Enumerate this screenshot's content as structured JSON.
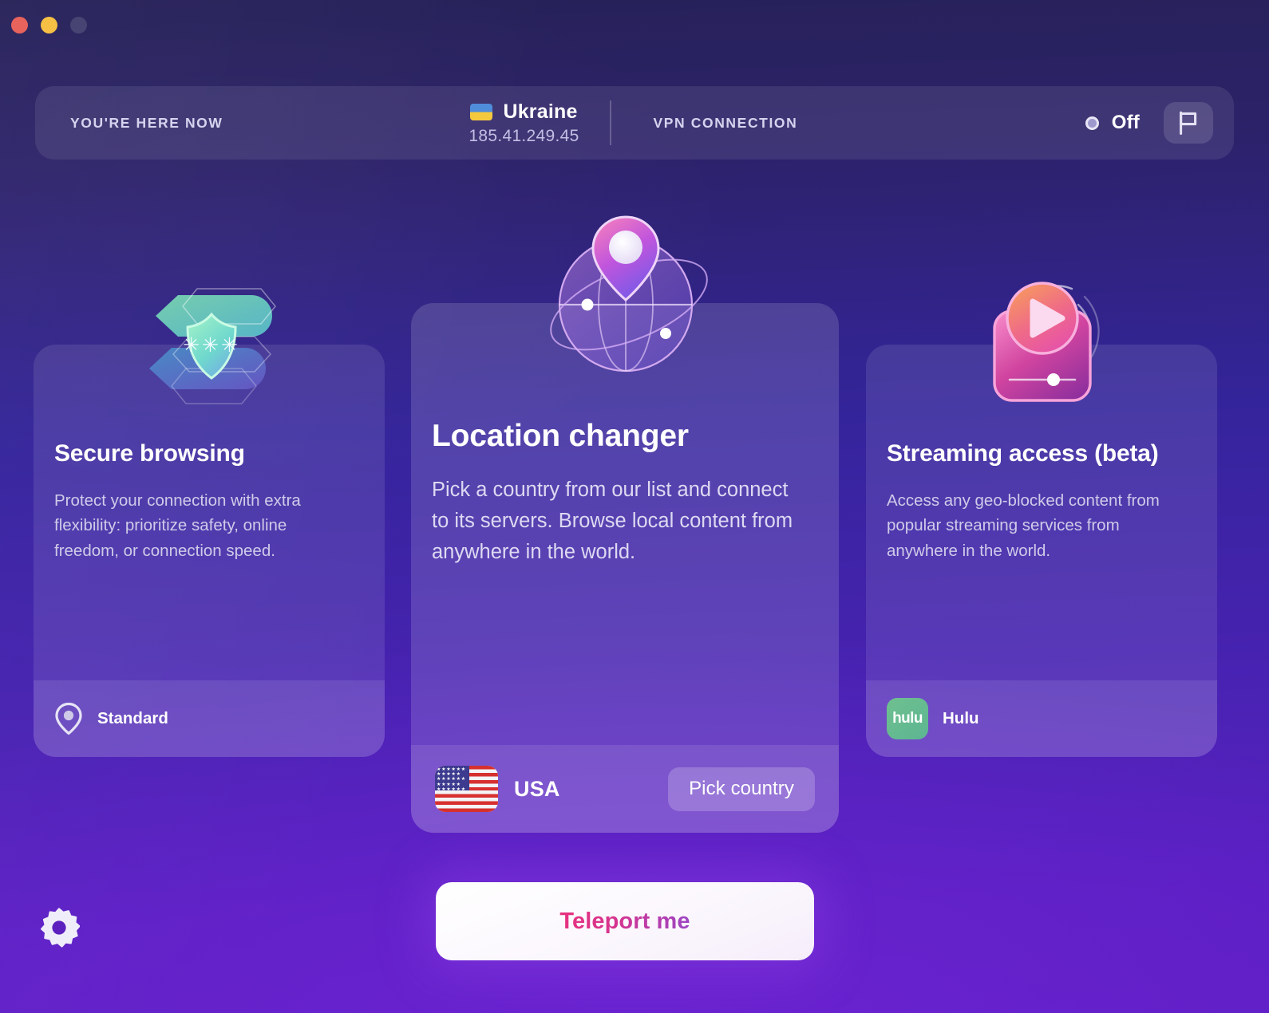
{
  "window": {
    "controls": [
      {
        "name": "close",
        "color": "#e8635c"
      },
      {
        "name": "minimize",
        "color": "#f5c043"
      },
      {
        "name": "zoom",
        "color": "#474473"
      }
    ]
  },
  "header": {
    "here_now_label": "YOU'RE HERE NOW",
    "country_name": "Ukraine",
    "country_flag": "ukraine-flag-icon",
    "ip_address": "185.41.249.45",
    "vpn_label": "VPN CONNECTION",
    "vpn_status": "Off",
    "status_icon": "status-ring-icon",
    "flag_button_icon": "flag-icon"
  },
  "cards": {
    "secure": {
      "icon": "shield-asterisks-icon",
      "title": "Secure browsing",
      "description": "Protect your connection with extra flexibility: prioritize safety, online freedom, or connection speed.",
      "footer_icon": "location-pin-icon",
      "footer_label": "Standard"
    },
    "location": {
      "icon": "globe-pin-icon",
      "title": "Location changer",
      "description": "Pick a country from our list and connect to its servers. Browse local content from anywhere in the world.",
      "footer_flag": "usa-flag-icon",
      "footer_label": "USA",
      "pick_button": "Pick country"
    },
    "streaming": {
      "icon": "video-player-icon",
      "title": "Streaming access (beta)",
      "description": "Access any geo-blocked content from popular streaming services from anywhere in the world.",
      "footer_icon": "hulu-logo-icon",
      "footer_badge_text": "hulu",
      "footer_label": "Hulu"
    }
  },
  "actions": {
    "teleport_label": "Teleport me",
    "settings_icon": "gear-icon"
  },
  "colors": {
    "accent_pink": "#e8317f",
    "accent_purple": "#9b45c6",
    "bg_top": "#262158",
    "bg_bottom": "#5d1ec4",
    "hulu_green": "#6fc08f"
  }
}
